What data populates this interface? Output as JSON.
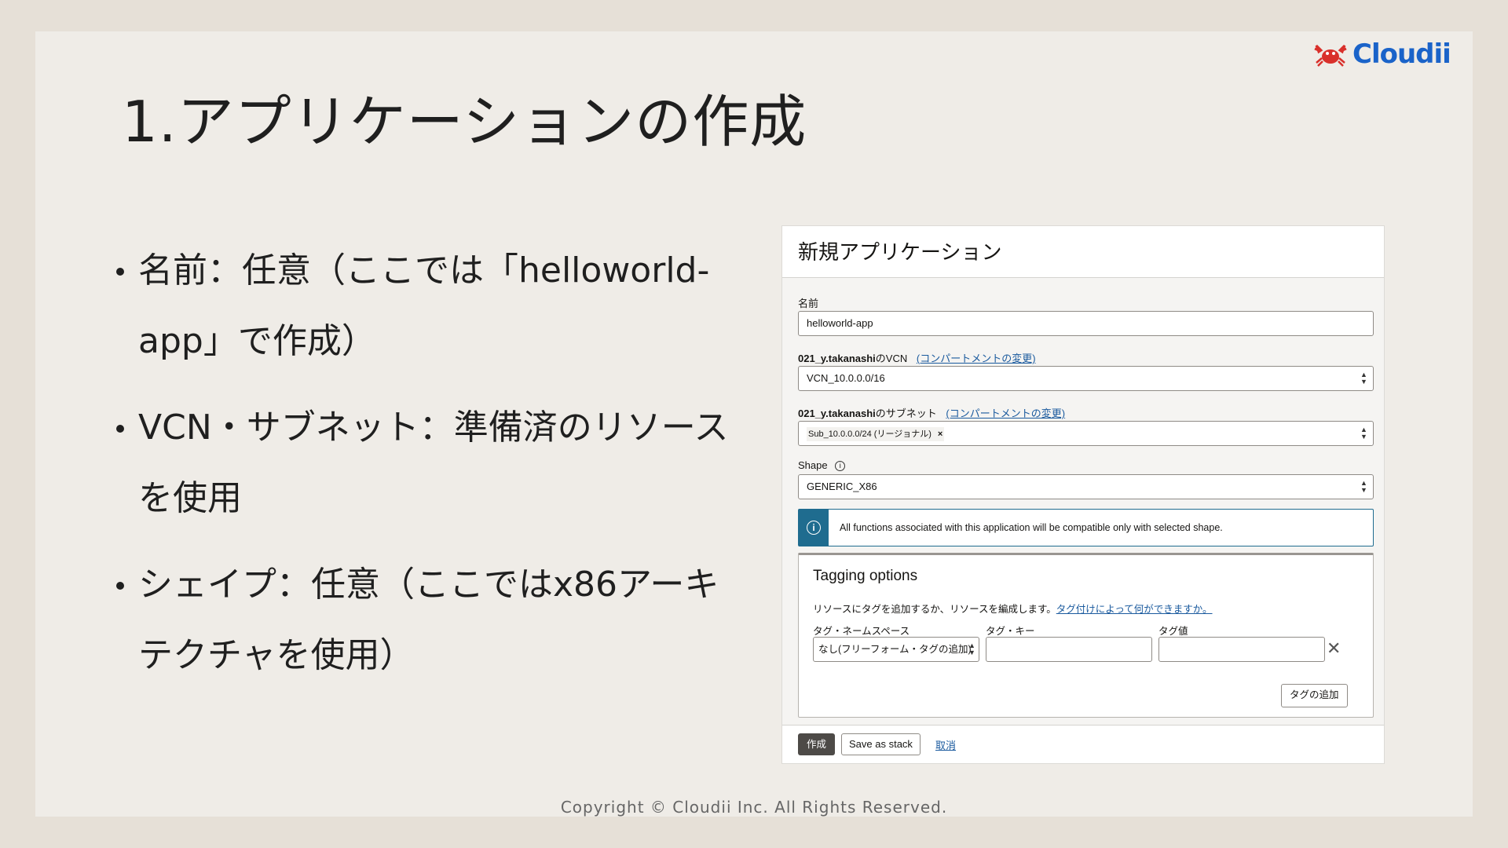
{
  "slide": {
    "title": "1.アプリケーションの作成",
    "bullets": [
      "名前：任意（ここでは「helloworld-app」で作成）",
      "VCN・サブネット：準備済のリソースを使用",
      "シェイプ：任意（ここではx86アーキテクチャを使用）"
    ],
    "logo_text": "Cloudii",
    "footer": "Copyright © Cloudii Inc. All Rights Reserved.",
    "brand_color": "#1a63c9"
  },
  "form": {
    "header": "新規アプリケーション",
    "name_label": "名前",
    "name_value": "helloworld-app",
    "vcn_label_compartment": "021_y.takanashi",
    "vcn_label_suffix": "のVCN",
    "vcn_change_link": "(コンパートメントの変更)",
    "vcn_value": "VCN_10.0.0.0/16",
    "subnet_label_compartment": "021_y.takanashi",
    "subnet_label_suffix": "のサブネット",
    "subnet_change_link": "(コンパートメントの変更)",
    "subnet_chip": "Sub_10.0.0.0/24 (リージョナル)",
    "subnet_chip_remove": "×",
    "shape_label": "Shape",
    "shape_value": "GENERIC_X86",
    "info_message": "All functions associated with this application will be compatible only with selected shape.",
    "tagging": {
      "title": "Tagging options",
      "description": "リソースにタグを追加するか、リソースを編成します。",
      "help_link": "タグ付けによって何ができますか。",
      "namespace_label": "タグ・ネームスペース",
      "namespace_value": "なし(フリーフォーム・タグの追加)",
      "key_label": "タグ・キー",
      "key_value": "",
      "value_label": "タグ値",
      "value_value": "",
      "add_tag_button": "タグの追加"
    },
    "footer": {
      "create_button": "作成",
      "save_stack_button": "Save as stack",
      "cancel_link": "取消"
    }
  }
}
